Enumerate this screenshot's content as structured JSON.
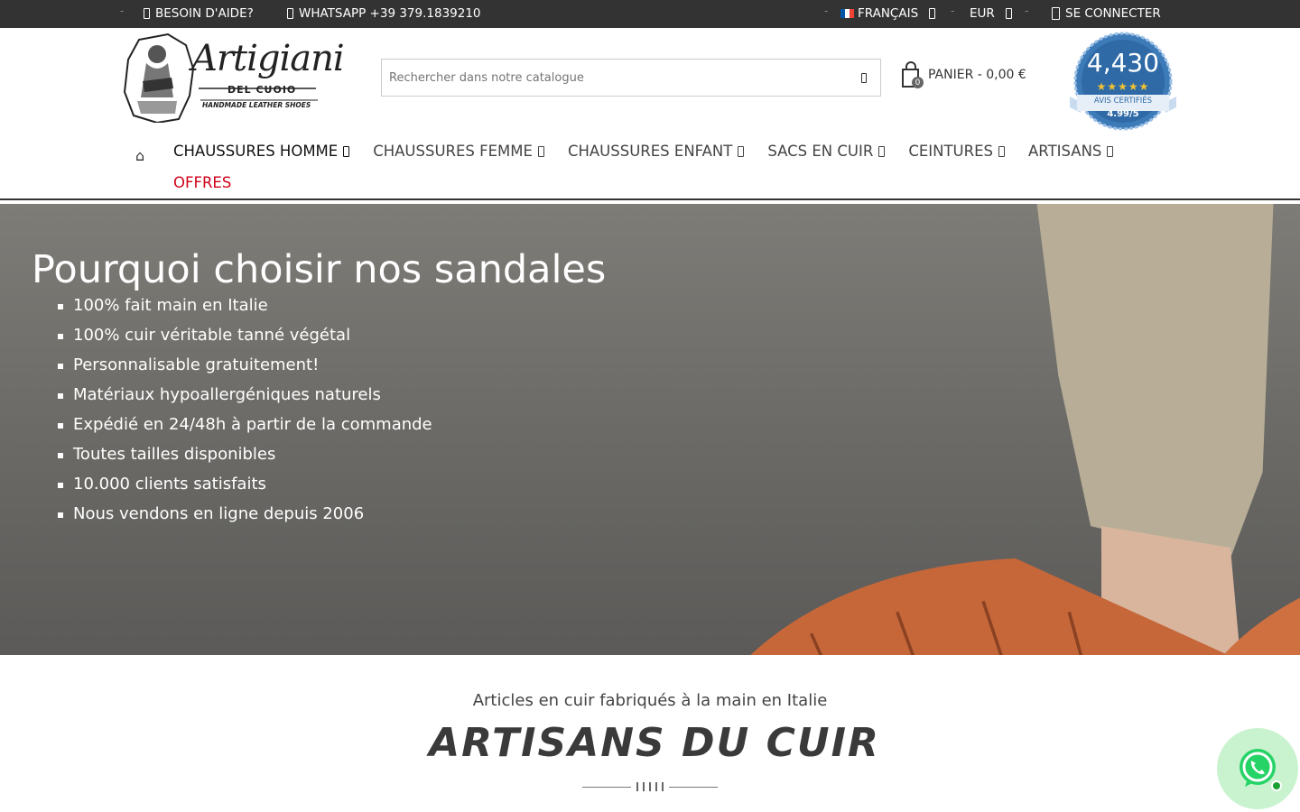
{
  "topbar": {
    "help_label": "BESOIN D'AIDE?",
    "whatsapp_label": "WHATSAPP +39 379.1839210",
    "language_label": "FRANÇAIS",
    "currency_label": "EUR",
    "login_label": "SE CONNECTER"
  },
  "header": {
    "logo_text": "Artigiani",
    "logo_sub": "DEL CUOIO",
    "logo_tagline": "HANDMADE LEATHER SHOES",
    "search_placeholder": "Rechercher dans notre catalogue",
    "cart_label": "PANIER - 0,00 €",
    "cart_count": "0",
    "reviews_count": "4,430",
    "reviews_stars": "★★★★★",
    "reviews_label": "AVIS CERTIFIÉS",
    "reviews_score": "4.99/5"
  },
  "nav": {
    "home_icon": "⌂",
    "items": [
      {
        "label": "CHAUSSURES HOMME"
      },
      {
        "label": "CHAUSSURES FEMME"
      },
      {
        "label": "CHAUSSURES ENFANT"
      },
      {
        "label": "SACS EN CUIR"
      },
      {
        "label": "CEINTURES"
      },
      {
        "label": "ARTISANS"
      }
    ],
    "offers_label": "OFFRES"
  },
  "hero": {
    "title": "Pourquoi choisir nos sandales",
    "bullets": [
      "100% fait main en Italie",
      "100% cuir véritable tanné végétal",
      "Personnalisable gratuitement!",
      "Matériaux hypoallergéniques naturels",
      "Expédié en 24/48h à partir de la commande",
      "Toutes tailles disponibles",
      "10.000 clients satisfaits",
      "Nous vendons en ligne depuis 2006"
    ]
  },
  "section": {
    "subtitle": "Articles en cuir fabriqués à la main en Italie",
    "headline": "ARTISANS DU CUIR"
  },
  "colors": {
    "topbar_bg": "#333333",
    "offers_red": "#d0021b",
    "leather": "#c8693a",
    "whatsapp_green": "#25d366"
  }
}
